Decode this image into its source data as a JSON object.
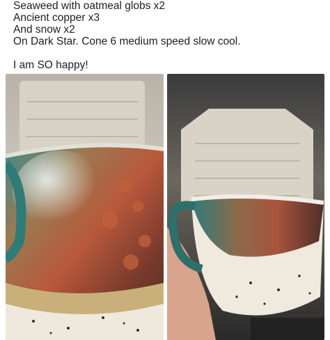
{
  "post": {
    "text_lines": [
      "Seaweed with oatmeal globs x2",
      "Ancient copper x3",
      "And snow x2",
      "On Dark Star. Cone 6 medium speed slow cool.",
      "I am SO happy!"
    ]
  },
  "photos": [
    {
      "subject": "glazed mug close-up in front of kiln"
    },
    {
      "subject": "glazed mug held in hand in front of kiln"
    }
  ],
  "colors": {
    "background": "#ffffff",
    "text": "#1c1e21",
    "page": "#f2f3f5"
  }
}
